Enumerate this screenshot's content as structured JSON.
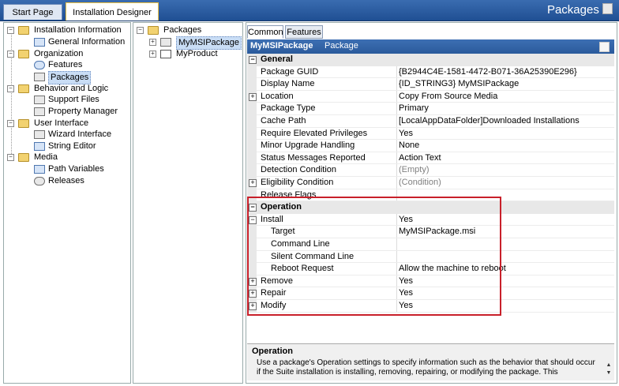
{
  "tabs": [
    {
      "label": "Start Page"
    },
    {
      "label": "Installation Designer"
    }
  ],
  "app_title": "Packages",
  "left_tree": {
    "items": [
      {
        "label": "Installation Information"
      },
      {
        "label": "General Information"
      },
      {
        "label": "Organization"
      },
      {
        "label": "Features"
      },
      {
        "label": "Packages"
      },
      {
        "label": "Behavior and Logic"
      },
      {
        "label": "Support Files"
      },
      {
        "label": "Property Manager"
      },
      {
        "label": "User Interface"
      },
      {
        "label": "Wizard Interface"
      },
      {
        "label": "String Editor"
      },
      {
        "label": "Media"
      },
      {
        "label": "Path Variables"
      },
      {
        "label": "Releases"
      }
    ]
  },
  "package_tree": {
    "root": "Packages",
    "items": [
      {
        "label": "MyMSIPackage"
      },
      {
        "label": "MyProduct"
      }
    ]
  },
  "property_tabs": [
    {
      "label": "Common"
    },
    {
      "label": "Features"
    }
  ],
  "grid_header": {
    "name": "MyMSIPackage",
    "kind": "Package"
  },
  "grid": {
    "general": "General",
    "package_guid": {
      "label": "Package GUID",
      "value": "{B2944C4E-1581-4472-B071-36A25390E296}"
    },
    "display_name": {
      "label": "Display Name",
      "value": "{ID_STRING3} MyMSIPackage"
    },
    "location": {
      "label": "Location",
      "value": "Copy From Source Media"
    },
    "package_type": {
      "label": "Package Type",
      "value": "Primary"
    },
    "cache_path": {
      "label": "Cache Path",
      "value": "[LocalAppDataFolder]Downloaded Installations"
    },
    "require_elevated": {
      "label": "Require Elevated Privileges",
      "value": "Yes"
    },
    "minor_upgrade": {
      "label": "Minor Upgrade Handling",
      "value": "None"
    },
    "status_messages": {
      "label": "Status Messages Reported",
      "value": "Action Text"
    },
    "detection": {
      "label": "Detection Condition",
      "value": "(Empty)"
    },
    "eligibility": {
      "label": "Eligibility Condition",
      "value": "(Condition)"
    },
    "release_flags": {
      "label": "Release Flags",
      "value": ""
    },
    "operation": "Operation",
    "install": {
      "label": "Install",
      "value": "Yes"
    },
    "target": {
      "label": "Target",
      "value": "MyMSIPackage.msi"
    },
    "command_line": {
      "label": "Command Line",
      "value": ""
    },
    "silent_command_line": {
      "label": "Silent Command Line",
      "value": ""
    },
    "reboot_request": {
      "label": "Reboot Request",
      "value": "Allow the machine to reboot"
    },
    "remove": {
      "label": "Remove",
      "value": "Yes"
    },
    "repair": {
      "label": "Repair",
      "value": "Yes"
    },
    "modify": {
      "label": "Modify",
      "value": "Yes"
    }
  },
  "description": {
    "title": "Operation",
    "text": "Use a package's Operation settings to specify information such as the behavior that should occur if the Suite installation is installing, removing, repairing, or modifying the package. This"
  },
  "colors": {
    "highlight": "#c8202a",
    "header": "#2a5a9b"
  }
}
